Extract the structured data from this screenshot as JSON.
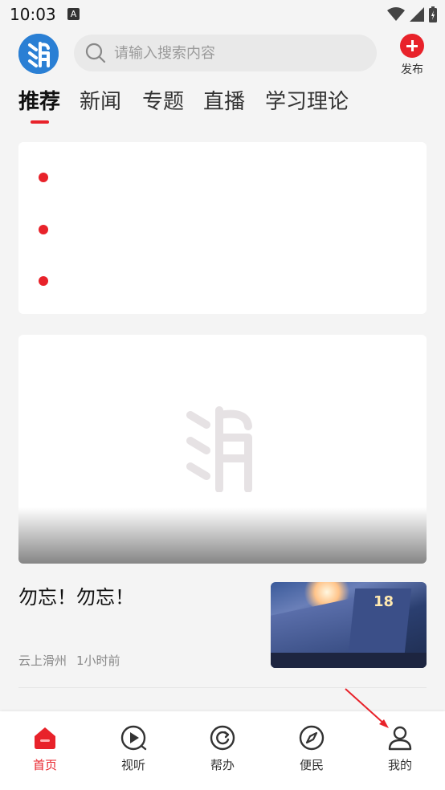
{
  "status_bar": {
    "time": "10:03",
    "notification_badge": "A"
  },
  "header": {
    "logo_icon": "app-logo-icon",
    "search": {
      "placeholder": "请输入搜索内容",
      "icon": "search-icon"
    },
    "publish": {
      "label": "发布",
      "icon": "plus-icon",
      "color": "#e8222a"
    }
  },
  "tabs": [
    {
      "label": "推荐",
      "active": true
    },
    {
      "label": "新闻",
      "active": false
    },
    {
      "label": "专题",
      "active": false
    },
    {
      "label": "直播",
      "active": false
    },
    {
      "label": "学习理论",
      "active": false
    }
  ],
  "headline_list": {
    "items": [
      "",
      "",
      ""
    ]
  },
  "news": [
    {
      "title": "勿忘！勿忘！",
      "source": "云上滑州",
      "time": "1小时前",
      "thumbnail_text": "18"
    }
  ],
  "bottom_nav": [
    {
      "label": "首页",
      "icon": "home-icon",
      "active": true
    },
    {
      "label": "视听",
      "icon": "play-circle-icon",
      "active": false
    },
    {
      "label": "帮办",
      "icon": "refresh-circle-icon",
      "active": false
    },
    {
      "label": "便民",
      "icon": "compass-icon",
      "active": false
    },
    {
      "label": "我的",
      "icon": "user-icon",
      "active": false
    }
  ],
  "colors": {
    "accent": "#e8222a",
    "logo_blue": "#2a7fd4",
    "background": "#f4f4f4"
  }
}
